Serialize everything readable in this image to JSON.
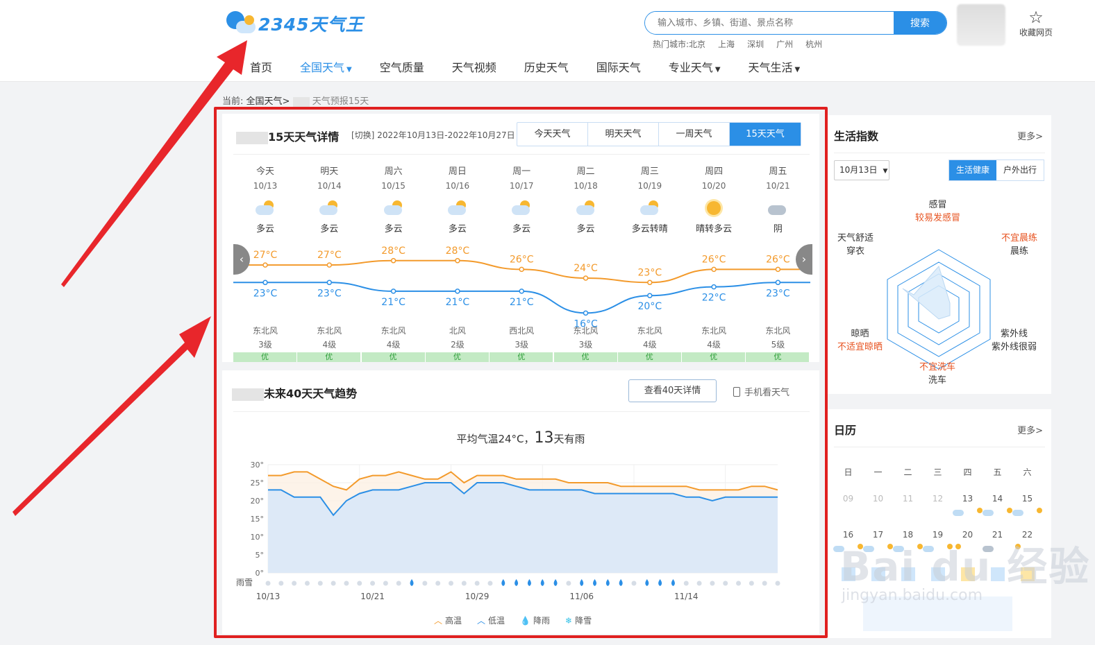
{
  "header": {
    "logo_text": "2345天气王",
    "search_placeholder": "输入城市、乡镇、街道、景点名称",
    "search_button": "搜索",
    "hot_cities_label": "热门城市:北京",
    "hot_cities": [
      "上海",
      "深圳",
      "广州",
      "杭州"
    ],
    "favorite_label": "收藏网页",
    "nav": [
      {
        "label": "首页",
        "dropdown": false
      },
      {
        "label": "全国天气",
        "dropdown": true,
        "active": true
      },
      {
        "label": "空气质量",
        "dropdown": false
      },
      {
        "label": "天气视频",
        "dropdown": false
      },
      {
        "label": "历史天气",
        "dropdown": false
      },
      {
        "label": "国际天气",
        "dropdown": false
      },
      {
        "label": "专业天气",
        "dropdown": true
      },
      {
        "label": "天气生活",
        "dropdown": true
      }
    ]
  },
  "breadcrumb": {
    "prefix": "当前:",
    "link": "全国天气>",
    "current": "天气预报15天"
  },
  "forecast15": {
    "title": "15天天气详情",
    "switch_label": "[切换] 2022年10月13日-2022年10月27日",
    "tabs": [
      "今天天气",
      "明天天气",
      "一周天气",
      "15天天气"
    ],
    "days": [
      {
        "name": "今天",
        "date": "10/13",
        "weather": "多云",
        "icon": "partly-cloudy",
        "high": "27°C",
        "low": "23°C",
        "wind": "东北风",
        "level": "3级",
        "aqi": "优"
      },
      {
        "name": "明天",
        "date": "10/14",
        "weather": "多云",
        "icon": "partly-cloudy",
        "high": "27°C",
        "low": "23°C",
        "wind": "东北风",
        "level": "4级",
        "aqi": "优"
      },
      {
        "name": "周六",
        "date": "10/15",
        "weather": "多云",
        "icon": "partly-cloudy",
        "high": "28°C",
        "low": "21°C",
        "wind": "东北风",
        "level": "4级",
        "aqi": "优"
      },
      {
        "name": "周日",
        "date": "10/16",
        "weather": "多云",
        "icon": "partly-cloudy",
        "high": "28°C",
        "low": "21°C",
        "wind": "北风",
        "level": "2级",
        "aqi": "优"
      },
      {
        "name": "周一",
        "date": "10/17",
        "weather": "多云",
        "icon": "partly-cloudy",
        "high": "26°C",
        "low": "21°C",
        "wind": "西北风",
        "level": "3级",
        "aqi": "优"
      },
      {
        "name": "周二",
        "date": "10/18",
        "weather": "多云",
        "icon": "partly-cloudy",
        "high": "24°C",
        "low": "16°C",
        "wind": "东北风",
        "level": "3级",
        "aqi": "优"
      },
      {
        "name": "周三",
        "date": "10/19",
        "weather": "多云转晴",
        "icon": "partly-cloudy",
        "high": "23°C",
        "low": "20°C",
        "wind": "东北风",
        "level": "4级",
        "aqi": "优"
      },
      {
        "name": "周四",
        "date": "10/20",
        "weather": "晴转多云",
        "icon": "sunny",
        "high": "26°C",
        "low": "22°C",
        "wind": "东北风",
        "level": "4级",
        "aqi": "优"
      },
      {
        "name": "周五",
        "date": "10/21",
        "weather": "阴",
        "icon": "overcast",
        "high": "26°C",
        "low": "23°C",
        "wind": "东北风",
        "level": "5级",
        "aqi": "优"
      }
    ],
    "high_values": [
      27,
      27,
      28,
      28,
      26,
      24,
      23,
      26,
      26
    ],
    "low_values": [
      23,
      23,
      21,
      21,
      21,
      16,
      20,
      22,
      23
    ]
  },
  "trend40": {
    "title": "未来40天天气趋势",
    "detail_button": "查看40天详情",
    "mobile_label": "手机看天气",
    "summary_prefix": "平均气温24°C，",
    "summary_number": "13",
    "summary_suffix": "天有雨",
    "legend": [
      "高温",
      "低温",
      "降雨",
      "降雪"
    ],
    "rain_row_label": "雨雪"
  },
  "chart_data": {
    "type": "area",
    "ylim": [
      0,
      30
    ],
    "y_ticks": [
      "30°",
      "25°",
      "20°",
      "15°",
      "10°",
      "5°",
      "0°"
    ],
    "x_tick_labels": [
      "10/13",
      "10/21",
      "10/29",
      "11/06",
      "11/14"
    ],
    "series": [
      {
        "name": "高温",
        "values": [
          27,
          27,
          28,
          28,
          26,
          24,
          23,
          26,
          27,
          27,
          28,
          27,
          26,
          26,
          28,
          25,
          27,
          27,
          27,
          26,
          26,
          26,
          26,
          25,
          25,
          25,
          25,
          24,
          24,
          24,
          24,
          24,
          24,
          23,
          23,
          23,
          23,
          24,
          24,
          23
        ]
      },
      {
        "name": "低温",
        "values": [
          23,
          23,
          21,
          21,
          21,
          16,
          20,
          22,
          23,
          23,
          23,
          24,
          25,
          25,
          25,
          22,
          25,
          25,
          25,
          24,
          23,
          23,
          23,
          23,
          23,
          22,
          22,
          22,
          22,
          22,
          22,
          22,
          21,
          21,
          20,
          21,
          21,
          21,
          21,
          21
        ]
      }
    ],
    "rain_days": [
      11,
      18,
      19,
      20,
      21,
      22,
      24,
      25,
      26,
      27,
      29,
      30,
      31
    ],
    "colors": {
      "high": "#f39a2b",
      "low": "#2b8fe6",
      "rain": "#2b8fe6"
    }
  },
  "life_index": {
    "title": "生活指数",
    "more": "更多>",
    "date": "10月13日",
    "tabs": [
      "生活健康",
      "户外出行"
    ],
    "items": [
      {
        "name": "感冒",
        "value": "较易发感冒",
        "warn": true
      },
      {
        "name": "不宜晨练",
        "value": "晨练",
        "warn": true
      },
      {
        "name": "紫外线",
        "value": "紫外线很弱",
        "warn": false
      },
      {
        "name": "不宜洗车",
        "value": "洗车",
        "warn": true
      },
      {
        "name": "晾晒",
        "value": "不适宜晾晒",
        "warn": true
      },
      {
        "name": "天气舒适",
        "value": "穿衣",
        "warn": false
      }
    ]
  },
  "calendar": {
    "title": "日历",
    "more": "更多>",
    "weekdays": [
      "日",
      "一",
      "二",
      "三",
      "四",
      "五",
      "六"
    ],
    "row1": [
      "09",
      "10",
      "11",
      "12",
      "13",
      "14",
      "15"
    ],
    "row2": [
      "16",
      "17",
      "18",
      "19",
      "20",
      "21",
      "22"
    ]
  }
}
